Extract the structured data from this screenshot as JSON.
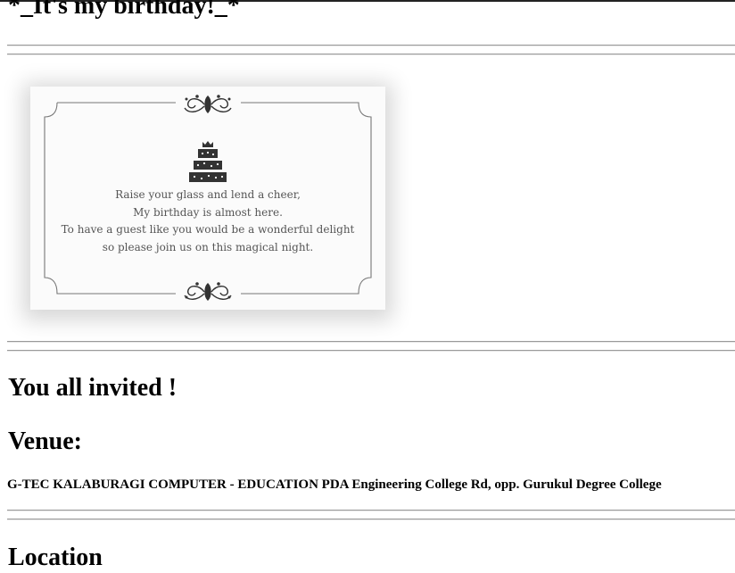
{
  "page": {
    "title": "*_It's my birthday!_*"
  },
  "invitation_card": {
    "lines": [
      "Raise your glass and lend a cheer,",
      "My birthday is almost here.",
      "To have a guest like you would be a wonderful delight",
      "so please join us on this magical night."
    ],
    "icons": [
      "flourish-ornament-icon",
      "birthday-cake-icon"
    ]
  },
  "invited": {
    "heading": "You all invited !"
  },
  "venue": {
    "heading": "Venue:",
    "address": "G-TEC KALABURAGI COMPUTER - EDUCATION PDA Engineering College Rd, opp. Gurukul Degree College"
  },
  "location": {
    "heading": "Location"
  }
}
